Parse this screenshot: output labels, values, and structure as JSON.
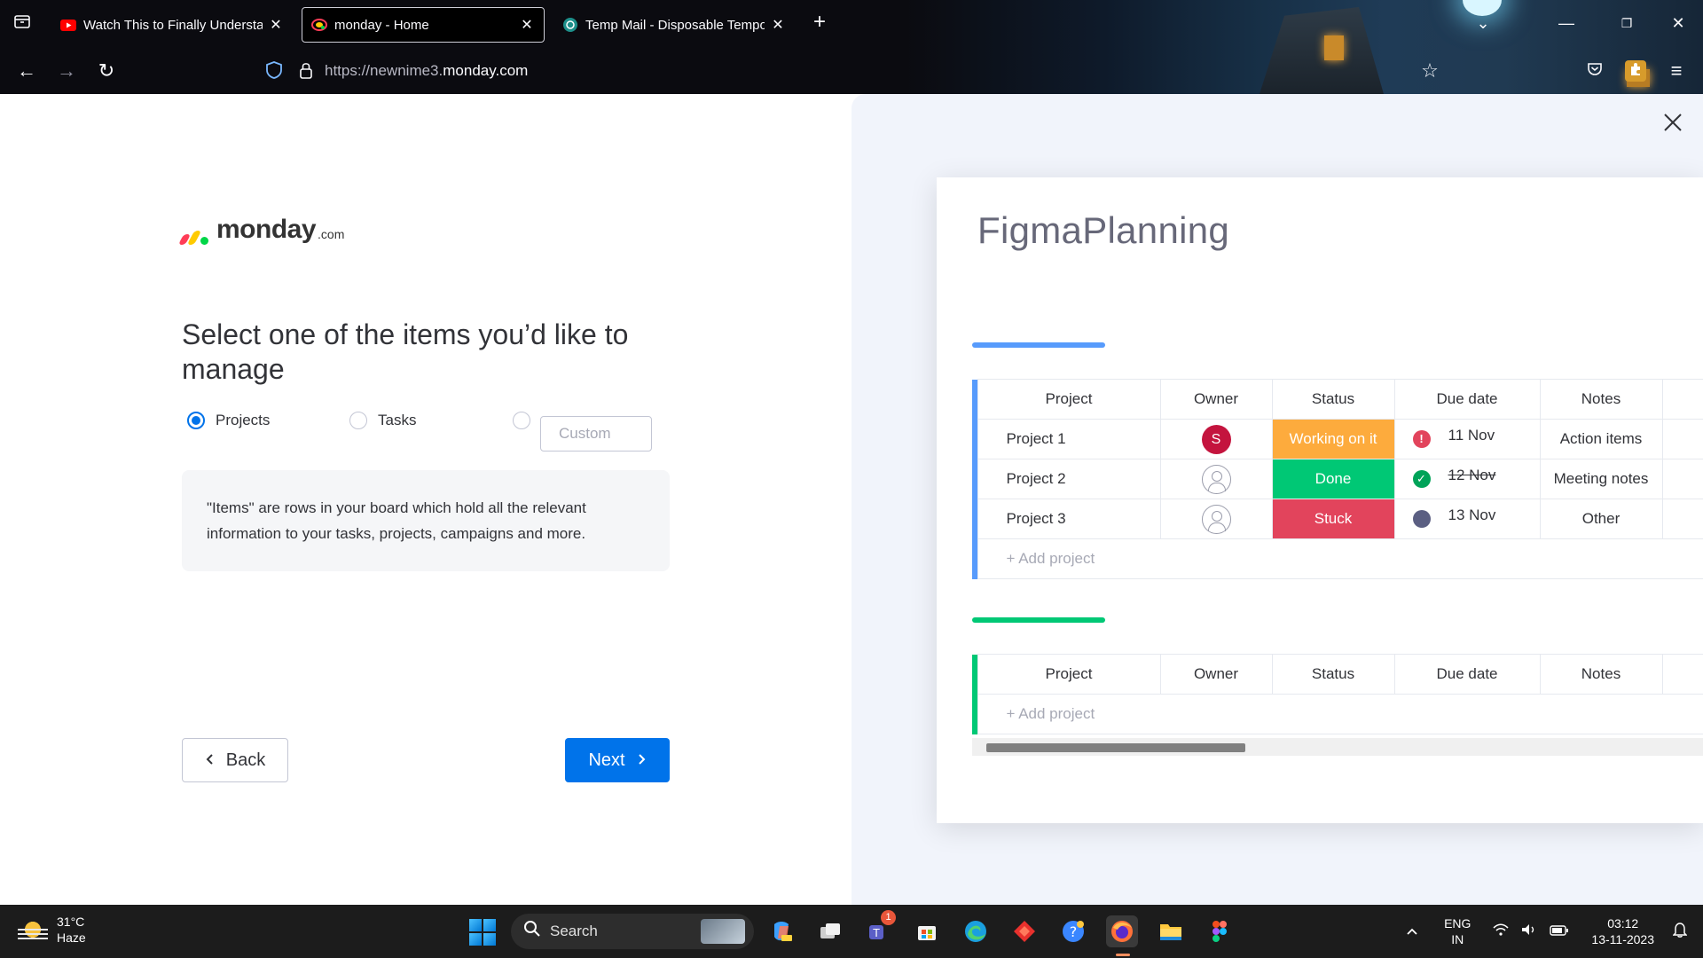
{
  "browser": {
    "tabs": [
      {
        "title": "Watch This to Finally Understand",
        "favicon": "youtube-icon",
        "active": false
      },
      {
        "title": "monday - Home",
        "favicon": "monday-icon",
        "active": true
      },
      {
        "title": "Temp Mail - Disposable Tempo",
        "favicon": "tempmail-icon",
        "active": false
      }
    ],
    "url_prefix": "https://newnime3.",
    "url_domain": "monday.com"
  },
  "onboarding": {
    "logo_word": "monday",
    "logo_suffix": ".com",
    "heading": "Select one of the items you’d like to manage",
    "options": [
      {
        "label": "Projects",
        "selected": true
      },
      {
        "label": "Tasks",
        "selected": false
      }
    ],
    "custom_placeholder": "Custom",
    "info_text": "\"Items\" are rows in your board which hold all the relevant information to your tasks, projects, campaigns and more.",
    "back_label": "Back",
    "next_label": "Next",
    "accent": "#0073ea"
  },
  "preview": {
    "board_title": "FigmaPlanning",
    "columns": [
      "Project",
      "Owner",
      "Status",
      "Due date",
      "Notes"
    ],
    "group1": {
      "color": "#579bfc",
      "rows": [
        {
          "name": "Project 1",
          "owner_initial": "S",
          "status": "Working on it",
          "status_color": "#fdab3d",
          "due_icon": "alert-icon",
          "due_color": "#e2445c",
          "due": "11 Nov",
          "due_struck": false,
          "notes": "Action items"
        },
        {
          "name": "Project 2",
          "owner_initial": "",
          "status": "Done",
          "status_color": "#00c875",
          "due_icon": "check-icon",
          "due_color": "#00a359",
          "due": "12 Nov",
          "due_struck": true,
          "notes": "Meeting notes"
        },
        {
          "name": "Project 3",
          "owner_initial": "",
          "status": "Stuck",
          "status_color": "#e2445c",
          "due_icon": "dot-icon",
          "due_color": "#5b5f82",
          "due": "13 Nov",
          "due_struck": false,
          "notes": "Other"
        }
      ],
      "add_label": "+ Add project"
    },
    "group2": {
      "color": "#00c875",
      "add_label": "+ Add project"
    }
  },
  "taskbar": {
    "temperature": "31°C",
    "weather": "Haze",
    "search_label": "Search",
    "teams_badge": "1",
    "lang_top": "ENG",
    "lang_bottom": "IN",
    "time": "03:12",
    "date": "13-11-2023"
  }
}
